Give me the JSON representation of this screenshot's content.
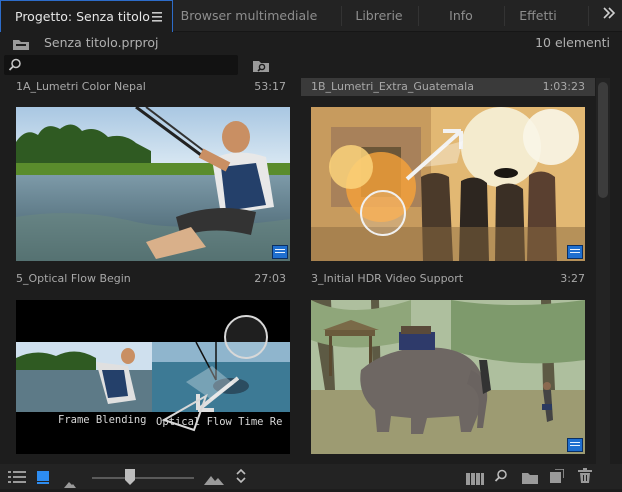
{
  "tabs": [
    {
      "label": "Progetto: Senza titolo",
      "active": true
    },
    {
      "label": "Browser multimediale"
    },
    {
      "label": "Librerie"
    },
    {
      "label": "Info"
    },
    {
      "label": "Effetti"
    }
  ],
  "project": {
    "file_name": "Senza titolo.prproj",
    "item_count": "10 elementi"
  },
  "search": {
    "placeholder": "",
    "value": ""
  },
  "clips": [
    {
      "name": "1A_Lumetri Color Nepal",
      "duration": "53:17",
      "selected": false
    },
    {
      "name": "1B_Lumetri_Extra_Guatemala",
      "duration": "1:03:23",
      "selected": true
    },
    {
      "name": "5_Optical Flow Begin",
      "duration": "27:03",
      "selected": false,
      "overlay_left": "Frame Blending",
      "overlay_right": "Optical Flow Time Re"
    },
    {
      "name": "3_Initial HDR Video Support",
      "duration": "3:27",
      "selected": false
    }
  ],
  "icons": {
    "panel_menu": "hamburger-icon",
    "overflow": "double-chevron-right-icon",
    "folder": "folder-icon",
    "search": "magnifier-icon",
    "find_bin": "find-in-bin-icon",
    "list_view": "list-view-icon",
    "icon_view": "icon-view-icon",
    "freeform": "freeform-view-icon",
    "zoom_small": "mountain-small-icon",
    "zoom_large": "mountain-large-icon",
    "sort": "sort-icon",
    "automate": "automate-to-sequence-icon",
    "find": "find-icon",
    "new_bin": "new-bin-icon",
    "new_item": "new-item-icon",
    "trash": "trash-icon"
  },
  "colors": {
    "accent": "#2d6cc9",
    "badge": "#1f6fcf",
    "panel": "#1d1d1d"
  },
  "zoom_level": 0.37
}
